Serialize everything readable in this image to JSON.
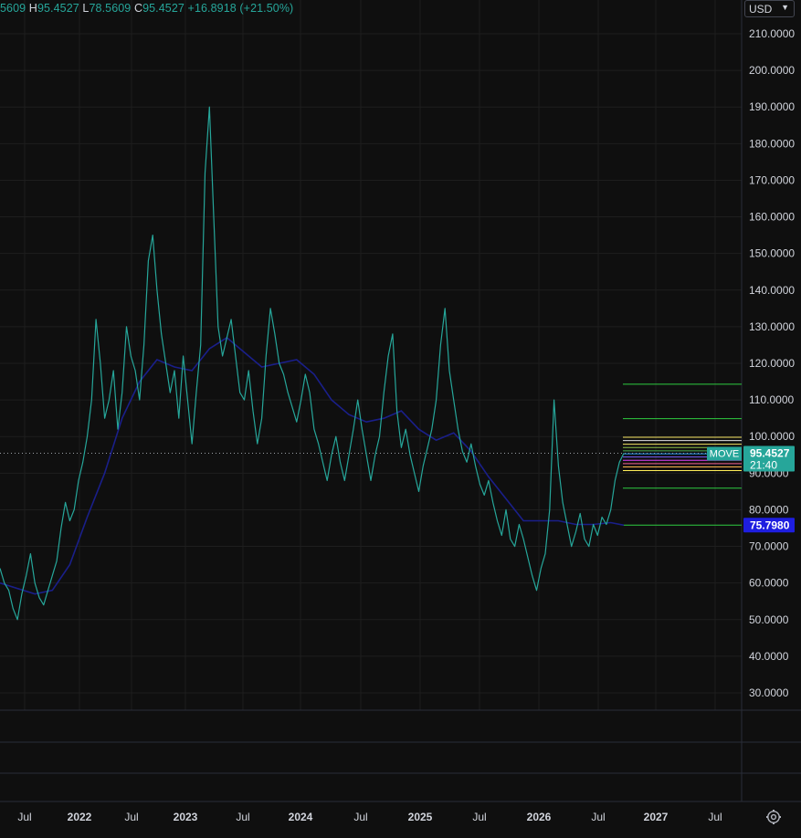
{
  "legend": {
    "open_fragment": "5609",
    "high_key": "H",
    "high_value": "95.4527",
    "low_key": "L",
    "low_value": "78.5609",
    "close_key": "C",
    "close_value": "95.4527",
    "change": "+16.8918 (+21.50%)"
  },
  "currency": {
    "label": "USD"
  },
  "colors": {
    "background": "#0f0f0f",
    "series": "#26a69a",
    "moving_average": "#1a1f8a",
    "axis_text": "#d1d4dc",
    "grid": "#1e1e1e",
    "price_badge": "#26a69a",
    "ma_badge": "#1e1ee0"
  },
  "badges": {
    "symbol": "MOVE",
    "price": "95.4527",
    "countdown": "21:40",
    "ma_price": "75.7980"
  },
  "icons": {
    "settings": "gear-icon",
    "dropdown": "chevron-down-icon"
  },
  "chart_data": {
    "type": "line",
    "ylim": [
      22,
      215
    ],
    "y_ticks": [
      "210.0000",
      "200.0000",
      "190.0000",
      "180.0000",
      "170.0000",
      "160.0000",
      "150.0000",
      "140.0000",
      "130.0000",
      "120.0000",
      "110.0000",
      "100.0000",
      "90.0000",
      "80.0000",
      "70.0000",
      "60.0000",
      "50.0000",
      "40.0000",
      "30.0000"
    ],
    "x_ticks": [
      "Jul",
      "2022",
      "Jul",
      "2023",
      "Jul",
      "2024",
      "Jul",
      "2025",
      "Jul",
      "2026",
      "Jul",
      "2027",
      "Jul"
    ],
    "last_price": 95.4527,
    "ma_value": 75.798,
    "series": [
      {
        "kind": "price",
        "points": [
          [
            0,
            64
          ],
          [
            1,
            60
          ],
          [
            2,
            58
          ],
          [
            3,
            53
          ],
          [
            4,
            50
          ],
          [
            5,
            57
          ],
          [
            6,
            62
          ],
          [
            7,
            68
          ],
          [
            8,
            60
          ],
          [
            9,
            56
          ],
          [
            10,
            54
          ],
          [
            11,
            58
          ],
          [
            12,
            62
          ],
          [
            13,
            66
          ],
          [
            14,
            75
          ],
          [
            15,
            82
          ],
          [
            16,
            77
          ],
          [
            17,
            80
          ],
          [
            18,
            88
          ],
          [
            19,
            93
          ],
          [
            20,
            100
          ],
          [
            21,
            110
          ],
          [
            22,
            132
          ],
          [
            23,
            120
          ],
          [
            24,
            105
          ],
          [
            25,
            110
          ],
          [
            26,
            118
          ],
          [
            27,
            102
          ],
          [
            28,
            112
          ],
          [
            29,
            130
          ],
          [
            30,
            122
          ],
          [
            31,
            118
          ],
          [
            32,
            110
          ],
          [
            33,
            125
          ],
          [
            34,
            148
          ],
          [
            35,
            155
          ],
          [
            36,
            140
          ],
          [
            37,
            128
          ],
          [
            38,
            120
          ],
          [
            39,
            112
          ],
          [
            40,
            118
          ],
          [
            41,
            105
          ],
          [
            42,
            122
          ],
          [
            43,
            110
          ],
          [
            44,
            98
          ],
          [
            45,
            112
          ],
          [
            46,
            125
          ],
          [
            47,
            172
          ],
          [
            48,
            190
          ],
          [
            49,
            160
          ],
          [
            50,
            130
          ],
          [
            51,
            122
          ],
          [
            52,
            127
          ],
          [
            53,
            132
          ],
          [
            54,
            122
          ],
          [
            55,
            112
          ],
          [
            56,
            110
          ],
          [
            57,
            118
          ],
          [
            58,
            107
          ],
          [
            59,
            98
          ],
          [
            60,
            105
          ],
          [
            61,
            122
          ],
          [
            62,
            135
          ],
          [
            63,
            128
          ],
          [
            64,
            120
          ],
          [
            65,
            117
          ],
          [
            66,
            112
          ],
          [
            67,
            108
          ],
          [
            68,
            104
          ],
          [
            69,
            110
          ],
          [
            70,
            117
          ],
          [
            71,
            112
          ],
          [
            72,
            102
          ],
          [
            73,
            98
          ],
          [
            74,
            93
          ],
          [
            75,
            88
          ],
          [
            76,
            95
          ],
          [
            77,
            100
          ],
          [
            78,
            93
          ],
          [
            79,
            88
          ],
          [
            80,
            95
          ],
          [
            81,
            102
          ],
          [
            82,
            110
          ],
          [
            83,
            102
          ],
          [
            84,
            95
          ],
          [
            85,
            88
          ],
          [
            86,
            95
          ],
          [
            87,
            100
          ],
          [
            88,
            112
          ],
          [
            89,
            122
          ],
          [
            90,
            128
          ],
          [
            91,
            107
          ],
          [
            92,
            97
          ],
          [
            93,
            102
          ],
          [
            94,
            95
          ],
          [
            95,
            90
          ],
          [
            96,
            85
          ],
          [
            97,
            92
          ],
          [
            98,
            97
          ],
          [
            99,
            102
          ],
          [
            100,
            110
          ],
          [
            101,
            125
          ],
          [
            102,
            135
          ],
          [
            103,
            118
          ],
          [
            104,
            110
          ],
          [
            105,
            102
          ],
          [
            106,
            96
          ],
          [
            107,
            93
          ],
          [
            108,
            98
          ],
          [
            109,
            92
          ],
          [
            110,
            87
          ],
          [
            111,
            84
          ],
          [
            112,
            88
          ],
          [
            113,
            82
          ],
          [
            114,
            77
          ],
          [
            115,
            73
          ],
          [
            116,
            80
          ],
          [
            117,
            72
          ],
          [
            118,
            70
          ],
          [
            119,
            76
          ],
          [
            120,
            72
          ],
          [
            121,
            67
          ],
          [
            122,
            62
          ],
          [
            123,
            58
          ],
          [
            124,
            64
          ],
          [
            125,
            68
          ],
          [
            126,
            80
          ],
          [
            127,
            110
          ],
          [
            128,
            92
          ],
          [
            129,
            82
          ],
          [
            130,
            76
          ],
          [
            131,
            70
          ],
          [
            132,
            74
          ],
          [
            133,
            79
          ],
          [
            134,
            72
          ],
          [
            135,
            70
          ],
          [
            136,
            76
          ],
          [
            137,
            73
          ],
          [
            138,
            78
          ],
          [
            139,
            76
          ],
          [
            140,
            80
          ],
          [
            141,
            88
          ],
          [
            142,
            93
          ],
          [
            143,
            95.4527
          ]
        ]
      },
      {
        "kind": "moving_average",
        "points": [
          [
            0,
            60
          ],
          [
            8,
            57
          ],
          [
            12,
            58
          ],
          [
            16,
            65
          ],
          [
            20,
            78
          ],
          [
            24,
            90
          ],
          [
            28,
            105
          ],
          [
            32,
            115
          ],
          [
            36,
            121
          ],
          [
            40,
            119
          ],
          [
            44,
            118
          ],
          [
            48,
            124
          ],
          [
            52,
            127
          ],
          [
            56,
            123
          ],
          [
            60,
            119
          ],
          [
            64,
            120
          ],
          [
            68,
            121
          ],
          [
            72,
            117
          ],
          [
            76,
            110
          ],
          [
            80,
            106
          ],
          [
            84,
            104
          ],
          [
            88,
            105
          ],
          [
            92,
            107
          ],
          [
            96,
            102
          ],
          [
            100,
            99
          ],
          [
            104,
            101
          ],
          [
            108,
            96
          ],
          [
            112,
            89
          ],
          [
            116,
            83
          ],
          [
            120,
            77
          ],
          [
            124,
            77
          ],
          [
            128,
            77
          ],
          [
            132,
            76
          ],
          [
            136,
            76
          ],
          [
            140,
            76.5
          ],
          [
            143,
            75.798
          ]
        ]
      }
    ],
    "horizontal_levels": [
      {
        "value": 114.3,
        "color": "#2ecc40"
      },
      {
        "value": 104.9,
        "color": "#2ecc40"
      },
      {
        "value": 99.8,
        "color": "#f5e663"
      },
      {
        "value": 98.9,
        "color": "#e0e0e0"
      },
      {
        "value": 97.9,
        "color": "#f5e663"
      },
      {
        "value": 97.0,
        "color": "#8bc34a"
      },
      {
        "value": 96.1,
        "color": "#4caf50"
      },
      {
        "value": 95.3,
        "color": "#2196f3"
      },
      {
        "value": 94.4,
        "color": "#7b61ff"
      },
      {
        "value": 93.5,
        "color": "#e040fb"
      },
      {
        "value": 92.6,
        "color": "#f06292"
      },
      {
        "value": 91.7,
        "color": "#ffb74d"
      },
      {
        "value": 90.7,
        "color": "#ffee58"
      },
      {
        "value": 85.9,
        "color": "#2ecc40"
      },
      {
        "value": 75.798,
        "color": "#2ecc40"
      }
    ]
  }
}
